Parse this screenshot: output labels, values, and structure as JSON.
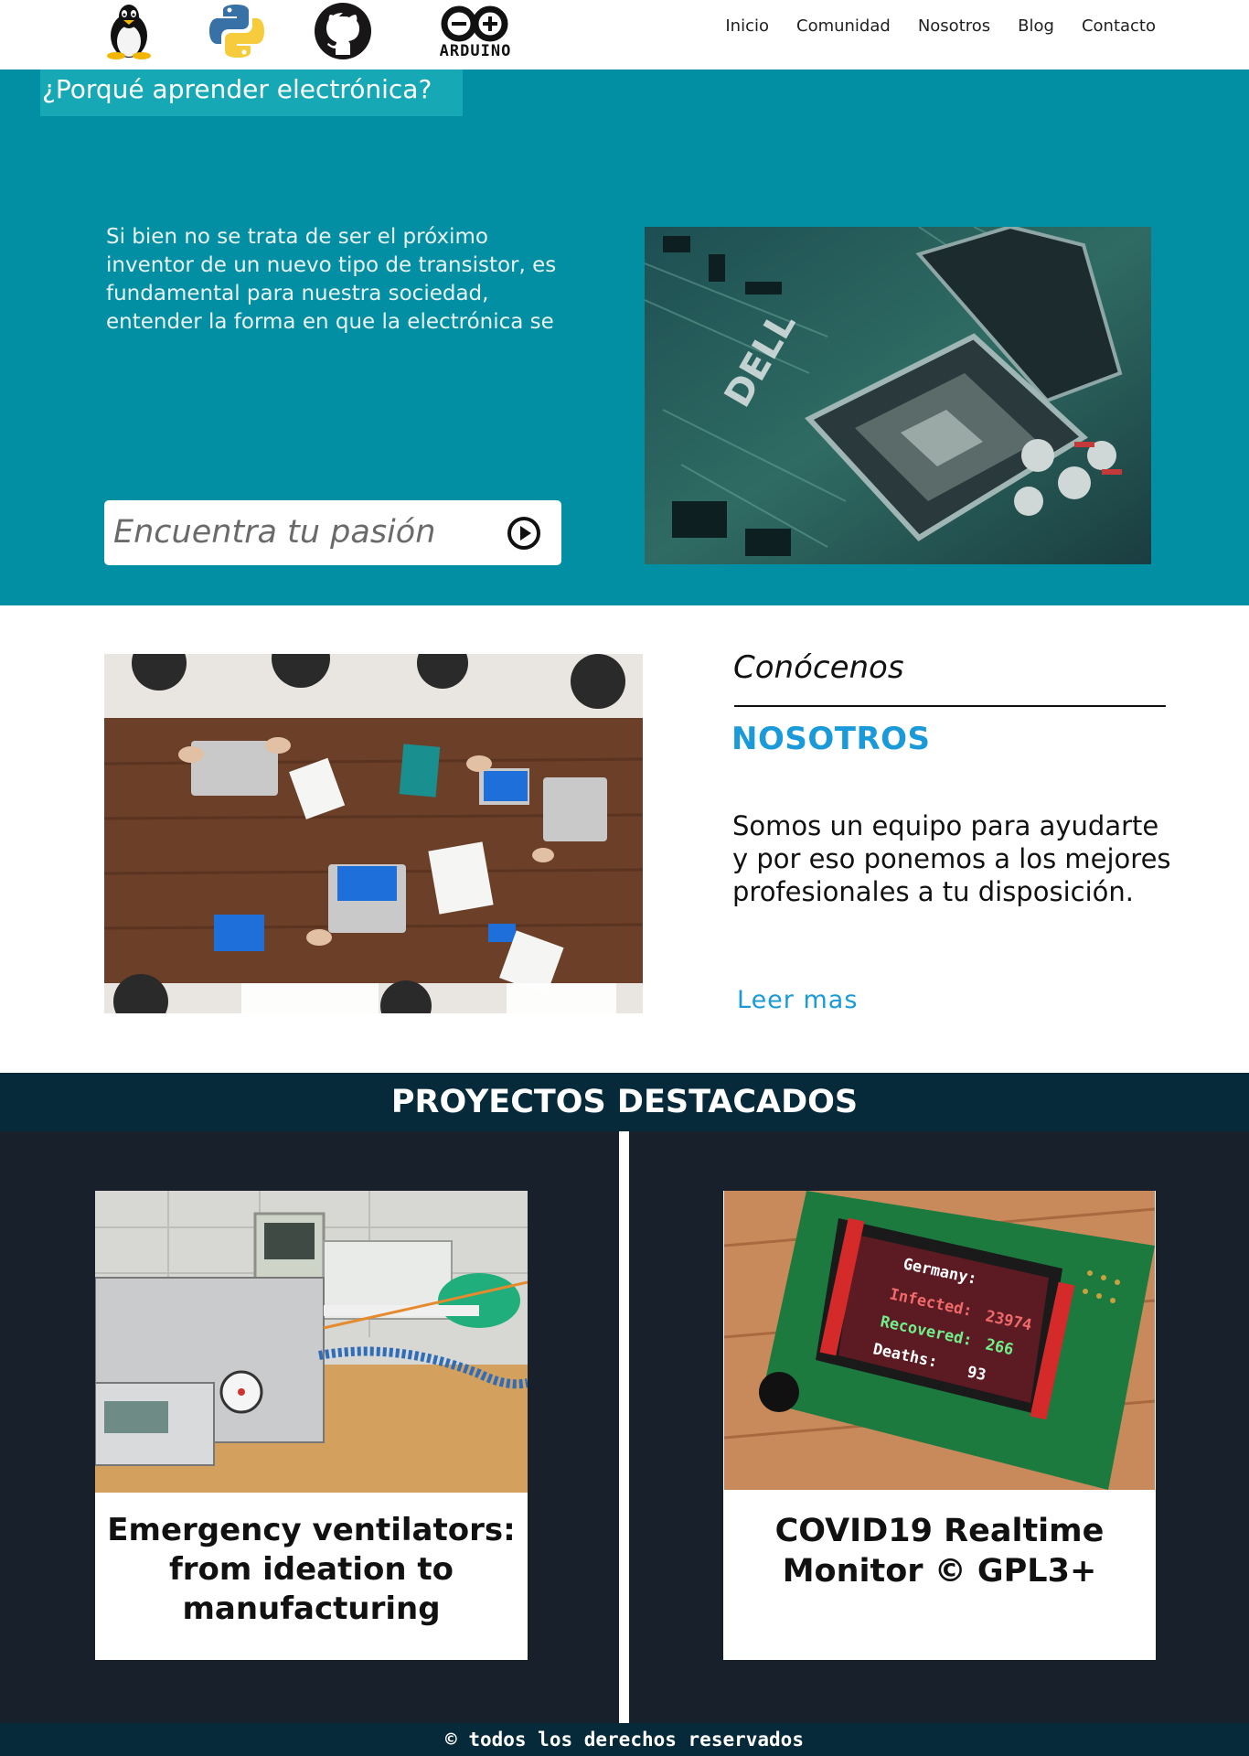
{
  "nav": {
    "logos": [
      "linux-icon",
      "python-icon",
      "github-icon",
      "arduino-icon"
    ],
    "arduino_logo_text": "ARDUINO",
    "menu": [
      "Inicio",
      "Comunidad",
      "Nosotros",
      "Blog",
      "Contacto"
    ]
  },
  "hero": {
    "title": "¿Porqué aprender electrónica?",
    "text": "Si bien no se trata de ser el próximo inventor de un nuevo tipo de transistor, es fundamental para nuestra sociedad, entender la forma en que la electrónica se",
    "search_placeholder": "Encuentra tu pasión",
    "image": "circuit-board-cpu-socket-photo",
    "background_color": "#038fa3"
  },
  "about": {
    "image": "team-meeting-laptops-table-photo",
    "kicker": "Conócenos",
    "heading": "NOSOTROS",
    "text": "Somos un equipo para ayudarte y por eso ponemos a los mejores profesionales a tu disposición.",
    "link": "Leer mas",
    "accent_color": "#1a9ad9"
  },
  "projects": {
    "title": "PROYECTOS DESTACADOS",
    "items": [
      {
        "title": "Emergency ventilators: from ideation to manufacturing",
        "image": "ventilator-lab-equipment-photo"
      },
      {
        "title": "COVID19 Realtime Monitor © GPL3+",
        "image": "arduino-lcd-covid-monitor-photo",
        "screen_lines": [
          "Germany:",
          "Infected:",
          "23974",
          "Recovered:",
          "266",
          "Deaths:",
          "93"
        ]
      }
    ]
  },
  "footer": {
    "text": "© todos los derechos reservados"
  }
}
